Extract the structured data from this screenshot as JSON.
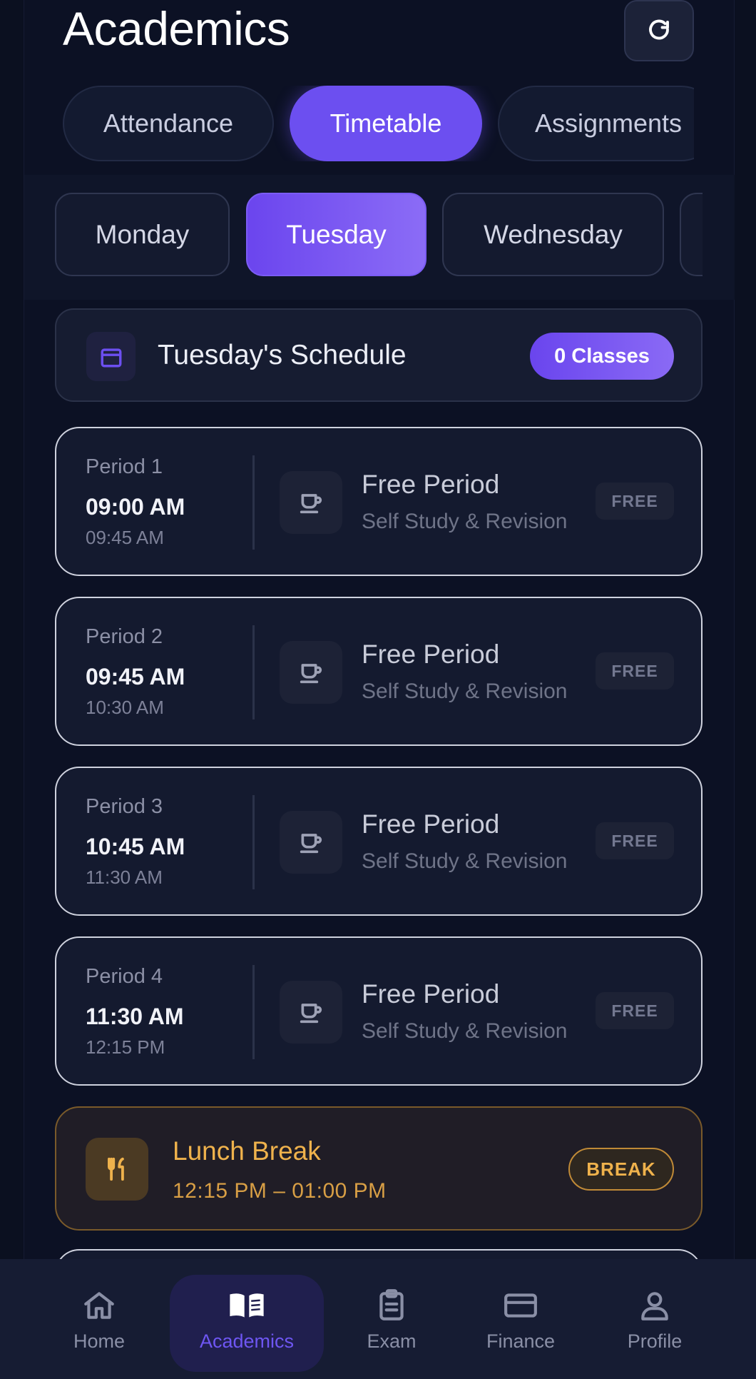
{
  "header": {
    "title": "Academics",
    "refresh_icon": "refresh-icon"
  },
  "tabs": [
    {
      "label": "Attendance",
      "active": false
    },
    {
      "label": "Timetable",
      "active": true
    },
    {
      "label": "Assignments",
      "active": false
    }
  ],
  "days": [
    {
      "label": "Monday",
      "active": false
    },
    {
      "label": "Tuesday",
      "active": true
    },
    {
      "label": "Wednesday",
      "active": false
    },
    {
      "label": "",
      "active": false
    }
  ],
  "schedule": {
    "title": "Tuesday's Schedule",
    "count_badge": "0 Classes",
    "icon": "calendar-icon"
  },
  "periods": [
    {
      "label": "Period 1",
      "start": "09:00 AM",
      "end": "09:45 AM",
      "subject": "Free Period",
      "desc": "Self Study & Revision",
      "tag": "FREE",
      "icon": "coffee-icon"
    },
    {
      "label": "Period 2",
      "start": "09:45 AM",
      "end": "10:30 AM",
      "subject": "Free Period",
      "desc": "Self Study & Revision",
      "tag": "FREE",
      "icon": "coffee-icon"
    },
    {
      "label": "Period 3",
      "start": "10:45 AM",
      "end": "11:30 AM",
      "subject": "Free Period",
      "desc": "Self Study & Revision",
      "tag": "FREE",
      "icon": "coffee-icon"
    },
    {
      "label": "Period 4",
      "start": "11:30 AM",
      "end": "12:15 PM",
      "subject": "Free Period",
      "desc": "Self Study & Revision",
      "tag": "FREE",
      "icon": "coffee-icon"
    }
  ],
  "lunch": {
    "title": "Lunch Break",
    "time": "12:15 PM  –  01:00 PM",
    "badge": "BREAK",
    "icon": "utensils-icon"
  },
  "nav": [
    {
      "label": "Home",
      "icon": "home-icon",
      "active": false
    },
    {
      "label": "Academics",
      "icon": "book-icon",
      "active": true
    },
    {
      "label": "Exam",
      "icon": "clipboard-icon",
      "active": false
    },
    {
      "label": "Finance",
      "icon": "card-icon",
      "active": false
    },
    {
      "label": "Profile",
      "icon": "user-icon",
      "active": false
    }
  ],
  "colors": {
    "accent": "#6c4ff0",
    "background": "#0c1124",
    "lunch": "#efb24c"
  }
}
